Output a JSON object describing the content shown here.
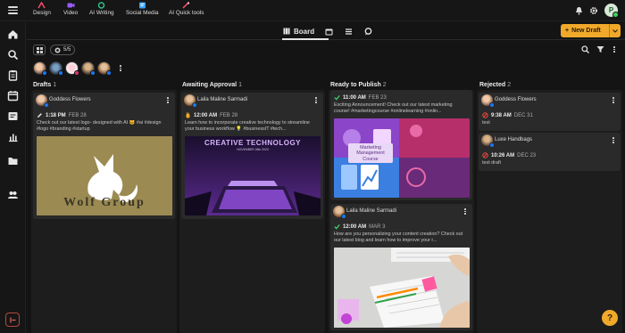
{
  "top_apps": [
    {
      "label": "Design",
      "icon": "design-icon"
    },
    {
      "label": "Video",
      "icon": "video-icon"
    },
    {
      "label": "AI Writing",
      "icon": "ai-writing-icon"
    },
    {
      "label": "Social Media",
      "icon": "social-media-icon"
    },
    {
      "label": "AI Quick tools",
      "icon": "ai-quick-tools-icon"
    }
  ],
  "user": {
    "initial": "P"
  },
  "views": {
    "board_label": "Board"
  },
  "new_draft": {
    "label": "New Draft"
  },
  "filters": {
    "account_count": "5/5"
  },
  "columns": [
    {
      "title": "Drafts",
      "count": "1"
    },
    {
      "title": "Awaiting Approval",
      "count": "1"
    },
    {
      "title": "Ready to Publish",
      "count": "2"
    },
    {
      "title": "Rejected",
      "count": "2"
    }
  ],
  "cards": {
    "drafts_1": {
      "author": "Goddess Flowers",
      "time": "1:18 PM",
      "date": "FEB 28",
      "text": "Check out our latest logo- designed with AI 🐱 #ai #design #logo #branding #startup",
      "image_text": "Wolf Group"
    },
    "awaiting_1": {
      "author": "Laila Maline Sarmadi",
      "time": "12:00 AM",
      "date": "FEB 28",
      "text": "Learn how to incorporate creative technology to streamline your business workflow 💡 #businessIT #tech...",
      "image_title": "CREATIVE TECHNOLOGY",
      "image_date": "NOVEMBER 26th 2023"
    },
    "ready_1": {
      "time": "11:00 AM",
      "date": "FEB 23",
      "text": "Exciting Announcement! Check out our latest marketing course! #marketingcourse #onlinelearning #onlin...",
      "image_title": "Marketing Management Course"
    },
    "ready_2": {
      "author": "Laila Maline Sarmadi",
      "time": "12:00 AM",
      "date": "MAR 3",
      "text": "How are you personalizing your content creation? Check out our latest blog and learn how to improve your r..."
    },
    "rejected_1": {
      "author": "Goddess Flowers",
      "time": "9:38 AM",
      "date": "DEC 31",
      "text": "test"
    },
    "rejected_2": {
      "author": "Luxe Handbags",
      "time": "10:26 AM",
      "date": "DEC 23",
      "text": "test draft"
    }
  },
  "help": {
    "label": "?"
  },
  "colors": {
    "accent": "#f0a92a",
    "background": "#141414",
    "card": "#2a2a2a",
    "facebook": "#1877f2",
    "rejected": "#e0483e",
    "approved": "#3ecf63"
  }
}
